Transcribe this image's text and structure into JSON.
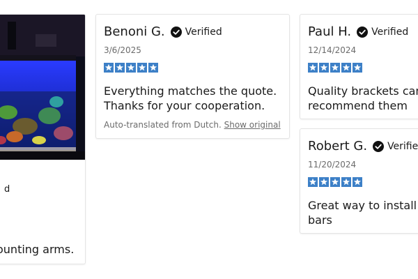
{
  "colors": {
    "star": "#3d80c7",
    "verified_badge": "#111111",
    "muted_text": "#6b6b6b"
  },
  "left_card": {
    "image_desc": "aquarium-photo",
    "verified_fragment": "d",
    "text_fragment": "ounting arms."
  },
  "reviews": [
    {
      "name": "Benoni G.",
      "verified_label": "Verified",
      "date": "3/6/2025",
      "rating": 5,
      "text_line1": "Everything matches the quote.",
      "text_line2": "Thanks for your cooperation.",
      "translation_note": "Auto-translated from Dutch.",
      "show_original_label": "Show original"
    },
    {
      "name": "Paul H.",
      "verified_label": "Verified",
      "date": "12/14/2024",
      "rating": 5,
      "text_line1": "Quality brackets can",
      "text_line2": "recommend them"
    },
    {
      "name": "Robert G.",
      "verified_label": "Verified",
      "date": "11/20/2024",
      "rating": 5,
      "text_line1": "Great way to install m",
      "text_line2": "bars"
    }
  ]
}
